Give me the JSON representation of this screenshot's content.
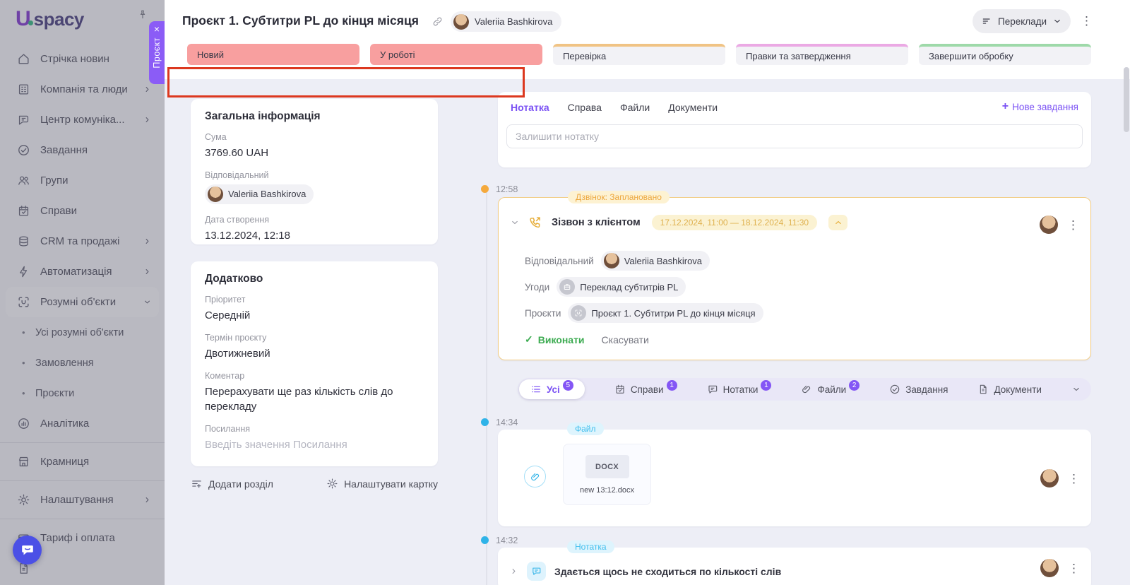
{
  "brand": {
    "logo_letter": "U",
    "logo_text": "spacy"
  },
  "icons": {
    "kebab": "⋮",
    "plus": "+",
    "close": "×",
    "check": "✓",
    "bullet": "•"
  },
  "colors": {
    "accent": "#7b52f4",
    "salmon": "#f89f9f",
    "orange": "#efa93e",
    "blue": "#2fb3e8",
    "green": "#3cab51",
    "stage_review": "#f0c384",
    "stage_edits": "#eba9e4",
    "stage_done": "#9ed9a9"
  },
  "sidebar": {
    "items": [
      {
        "label": "Стрічка новин"
      },
      {
        "label": "Компанія та люди"
      },
      {
        "label": "Центр комуніка..."
      },
      {
        "label": "Завдання"
      },
      {
        "label": "Групи"
      },
      {
        "label": "Справи"
      },
      {
        "label": "CRM та продажі"
      },
      {
        "label": "Автоматизація"
      },
      {
        "label": "Розумні об'єкти"
      },
      {
        "label": "Аналітика"
      },
      {
        "label": "Крамниця"
      },
      {
        "label": "Налаштування"
      },
      {
        "label": "Тариф і оплата"
      }
    ],
    "subitems": [
      {
        "label": "Усі розумні об'єкти"
      },
      {
        "label": "Замовлення"
      },
      {
        "label": "Проєкти"
      }
    ]
  },
  "slideover": {
    "tab": "Проєкт"
  },
  "header": {
    "title": "Проєкт 1. Субтитри PL до кінця місяця",
    "owner": "Valeriia Bashkirova",
    "view_selector": "Переклади"
  },
  "stages": [
    {
      "label": "Новий"
    },
    {
      "label": "У роботі"
    },
    {
      "label": "Перевірка"
    },
    {
      "label": "Правки та затвердження"
    },
    {
      "label": "Завершити обробку"
    }
  ],
  "panel": {
    "general": {
      "title": "Загальна інформація",
      "sum_label": "Сума",
      "sum_value": "3769.60 UAH",
      "resp_label": "Відповідальний",
      "resp_value": "Valeriia Bashkirova",
      "created_label": "Дата створення",
      "created_value": "13.12.2024, 12:18"
    },
    "extra": {
      "title": "Додатково",
      "priority_label": "Пріоритет",
      "priority_value": "Середній",
      "term_label": "Термін проєкту",
      "term_value": "Двотижневий",
      "comment_label": "Коментар",
      "comment_value": "Перерахувати ще раз кількість слів до перекладу",
      "link_label": "Посилання",
      "link_placeholder": "Введіть значення Посилання"
    },
    "footer": {
      "add_section": "Додати розділ",
      "configure_card": "Налаштувати картку"
    }
  },
  "composer": {
    "tabs": [
      {
        "label": "Нотатка"
      },
      {
        "label": "Справа"
      },
      {
        "label": "Файли"
      },
      {
        "label": "Документи"
      }
    ],
    "new_task": "Нове завдання",
    "note_placeholder": "Залишити нотатку"
  },
  "feed": {
    "call": {
      "time": "12:58",
      "badge": "Дзвінок: Заплановано",
      "title": "Зізвон з клієнтом",
      "period": "17.12.2024, 11:00 — 18.12.2024, 11:30",
      "resp_label": "Відповідальний",
      "resp_value": "Valeriia Bashkirova",
      "deals_label": "Угоди",
      "deals_value": "Переклад субтитрів PL",
      "projects_label": "Проєкти",
      "projects_value": "Проєкт 1. Субтитри PL до кінця місяця",
      "done": "Виконати",
      "cancel": "Скасувати"
    },
    "filter": {
      "tabs": [
        {
          "label": "Усі",
          "count": "5"
        },
        {
          "label": "Справи",
          "count": "1"
        },
        {
          "label": "Нотатки",
          "count": "1"
        },
        {
          "label": "Файли",
          "count": "2"
        },
        {
          "label": "Завдання"
        },
        {
          "label": "Документи"
        }
      ]
    },
    "file": {
      "time": "14:34",
      "badge": "Файл",
      "type": "DOCX",
      "name": "new 13:12.docx"
    },
    "note": {
      "time": "14:32",
      "badge": "Нотатка",
      "text": "Здається щось не сходиться по кількості слів"
    }
  }
}
